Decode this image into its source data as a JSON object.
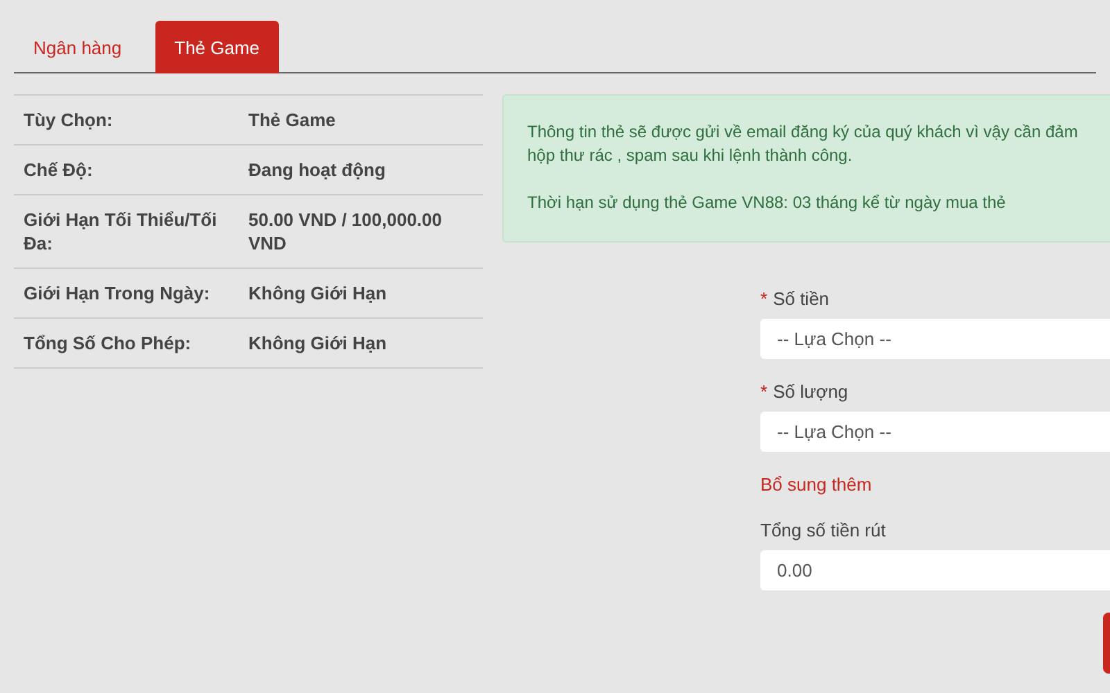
{
  "tabs": [
    {
      "label": "Ngân hàng",
      "selected": false
    },
    {
      "label": "Thẻ Game",
      "selected": true
    }
  ],
  "details": [
    {
      "label": "Tùy Chọn:",
      "value": "Thẻ Game"
    },
    {
      "label": "Chế Độ:",
      "value": "Đang hoạt động"
    },
    {
      "label": "Giới Hạn Tối Thiểu/Tối Đa:",
      "value": "50.00 VND / 100,000.00 VND"
    },
    {
      "label": "Giới Hạn Trong Ngày:",
      "value": "Không Giới Hạn"
    },
    {
      "label": "Tổng Số Cho Phép:",
      "value": "Không Giới Hạn"
    }
  ],
  "notice": {
    "lines": [
      "Thông tin thẻ sẽ được gửi về email đăng ký của quý khách vì vậy cần đảm",
      "hộp thư rác , spam sau khi lệnh thành công."
    ],
    "validity": "Thời hạn sử dụng thẻ Game VN88: 03 tháng kể từ ngày mua thẻ"
  },
  "form": [
    {
      "kind": "select",
      "required": true,
      "required_mark": "*",
      "label": "Số tiền",
      "value": "-- Lựa Chọn --"
    },
    {
      "kind": "select",
      "required": true,
      "required_mark": "*",
      "label": "Số lượng",
      "value": "-- Lựa Chọn --"
    },
    {
      "kind": "link",
      "label": "Bổ sung thêm"
    },
    {
      "kind": "input",
      "required": false,
      "label": "Tổng số tiền rút",
      "value": "0.00"
    }
  ],
  "submit_button": {
    "kind": "button"
  }
}
